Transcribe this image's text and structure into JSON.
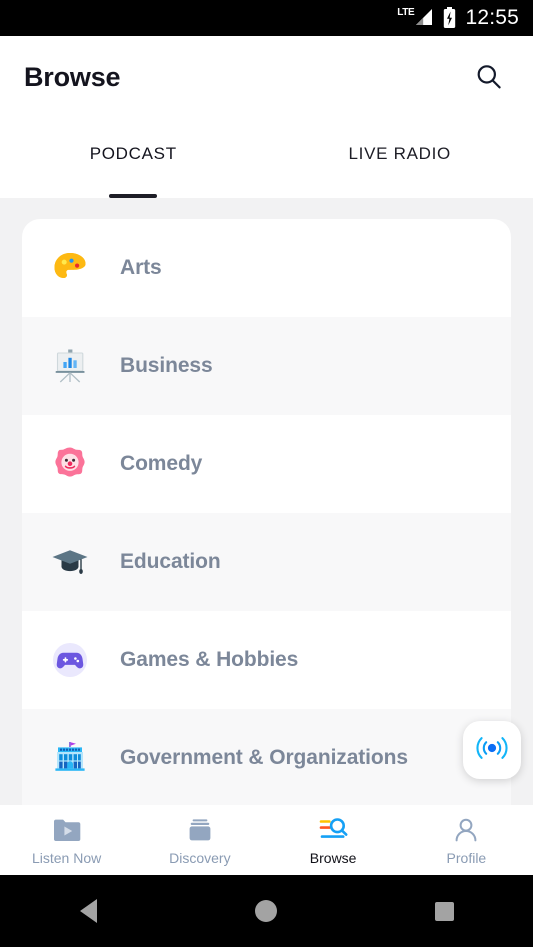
{
  "status_bar": {
    "network_label": "LTE",
    "signal_icon": "signal-bars-icon",
    "battery_icon": "battery-charging-icon",
    "time": "12:55"
  },
  "appbar": {
    "title": "Browse",
    "search_icon": "search-icon"
  },
  "tabs": [
    {
      "label": "PODCAST",
      "active": true
    },
    {
      "label": "LIVE RADIO",
      "active": false
    }
  ],
  "categories": [
    {
      "label": "Arts",
      "icon": "artist-palette-icon"
    },
    {
      "label": "Business",
      "icon": "bar-chart-easel-icon"
    },
    {
      "label": "Comedy",
      "icon": "clown-face-icon"
    },
    {
      "label": "Education",
      "icon": "graduation-cap-icon"
    },
    {
      "label": "Games & Hobbies",
      "icon": "game-controller-icon"
    },
    {
      "label": "Government & Organizations",
      "icon": "classical-building-icon"
    }
  ],
  "fab": {
    "icon": "radio-broadcast-icon",
    "accent_color": "#0a8af0"
  },
  "bottom_nav": [
    {
      "label": "Listen Now",
      "icon": "folder-play-icon",
      "active": false
    },
    {
      "label": "Discovery",
      "icon": "stacked-discs-icon",
      "active": false
    },
    {
      "label": "Browse",
      "icon": "browse-search-icon",
      "active": true
    },
    {
      "label": "Profile",
      "icon": "person-icon",
      "active": false
    }
  ],
  "android_nav": [
    {
      "icon": "back-triangle-icon"
    },
    {
      "icon": "home-circle-icon"
    },
    {
      "icon": "recents-square-icon"
    }
  ],
  "colors": {
    "page_background": "#f2f2f3",
    "card_background": "#ffffff",
    "row_alt_background": "#f8f8f9",
    "category_text": "#7c8799",
    "nav_inactive": "#8a9bb3",
    "nav_active": "#111118",
    "accent_blue": "#0a8af0"
  }
}
